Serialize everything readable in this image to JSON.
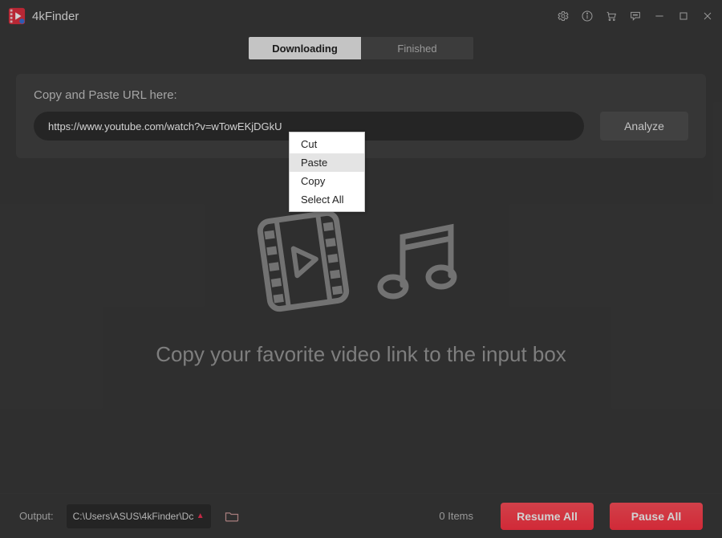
{
  "app": {
    "title": "4kFinder"
  },
  "titlebar_icons": [
    "settings",
    "info",
    "cart",
    "feedback",
    "minimize",
    "maximize",
    "close"
  ],
  "tabs": {
    "downloading": "Downloading",
    "finished": "Finished"
  },
  "url_panel": {
    "label": "Copy and Paste URL here:",
    "value": "https://www.youtube.com/watch?v=wTowEKjDGkU",
    "analyze": "Analyze"
  },
  "context_menu": {
    "cut": "Cut",
    "paste": "Paste",
    "copy": "Copy",
    "select_all": "Select All"
  },
  "hint": "Copy your favorite video link to the input box",
  "bottombar": {
    "output_label": "Output:",
    "output_path": "C:\\Users\\ASUS\\4kFinder\\Dc",
    "items": "0 Items",
    "resume": "Resume All",
    "pause": "Pause All"
  }
}
